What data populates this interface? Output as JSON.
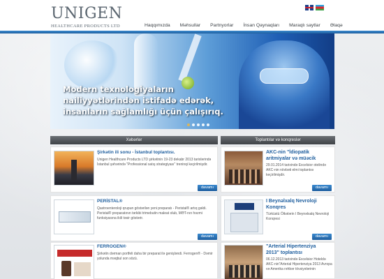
{
  "header": {
    "logo_main": "UNIGEN",
    "logo_sub": "HEALTHCARE PRODUCTS LTD",
    "lang_en": "EN",
    "lang_az": "AZ"
  },
  "nav": [
    "Haqqımızda",
    "Məhsullar",
    "Partnyorlar",
    "İnsan Qaynaqları",
    "Maraqlı saytlar",
    "Əlaqə"
  ],
  "hero": {
    "line1": "Modern texnologiyaların",
    "line2": "nailiyyətlərindən istifadə edərək,",
    "line3": "insanların sağlamlığı üçün çalışırıq."
  },
  "left_column": {
    "header": "Xəbərlər",
    "items": [
      {
        "title": "Şirkətin ili sonu - İstanbul toplantısı.",
        "excerpt": "Unigen Healthcare Products LTD şirkətinin 19-23 dekabr 2013 tarixlərində İstanbul şəhərində \"Professional satış strategiyası\" treninqi keçirilmişdir.",
        "more": "davamı"
      },
      {
        "title": "PERİSTAL®",
        "excerpt": "Qastroenteroloji qrupun göstərilən yeni preparatı - Peristal® artıq gəldi. Peristal® preparatının tərkibi trimebutin maleat olub, MƏT-nın həzmi funksiyasına ikili təsir göstərir.",
        "more": "davamı"
      },
      {
        "title": "FERROGEN®",
        "excerpt": "Şirkətin dərman portfeli daha bir preparat ilə genişləndi. Ferrogen® - Dəmir yolunda məqbul son sözü.",
        "more": ""
      }
    ]
  },
  "right_column": {
    "header": "Toplantılar və konqreslər",
    "items": [
      {
        "title_line1": "AKC-nin \"İdiopatik",
        "title_line2": "aritmiyalar və müəcik",
        "excerpt": "29.01.2014 tarixində Excelsior otelində AKC-nin növbəti elmi toplantısı keçirilmişdir.",
        "more": "davamı"
      },
      {
        "title_line1": "I Beynəlxalq Nevroloji",
        "title_line2": "Konqres",
        "excerpt": "Türküstü Ölkələrin I Beynəlxalq Nevroloji Konqresi",
        "more": "davamı"
      },
      {
        "title_line1": "\"Arterial Hipertenziya",
        "title_line2": "2013\" toplantısı",
        "excerpt": "06.12.2013 tarixində Excelsior Hoteldə AKC-nin\"Arterial Hipertenziya 2013 Avropa və Amerika rəhbər tövsiyələrinin",
        "more": ""
      }
    ]
  },
  "colors": {
    "brand_blue": "#1e5e9e",
    "header_bar": "#3a8ad0",
    "column_header": "#4a4e52"
  }
}
